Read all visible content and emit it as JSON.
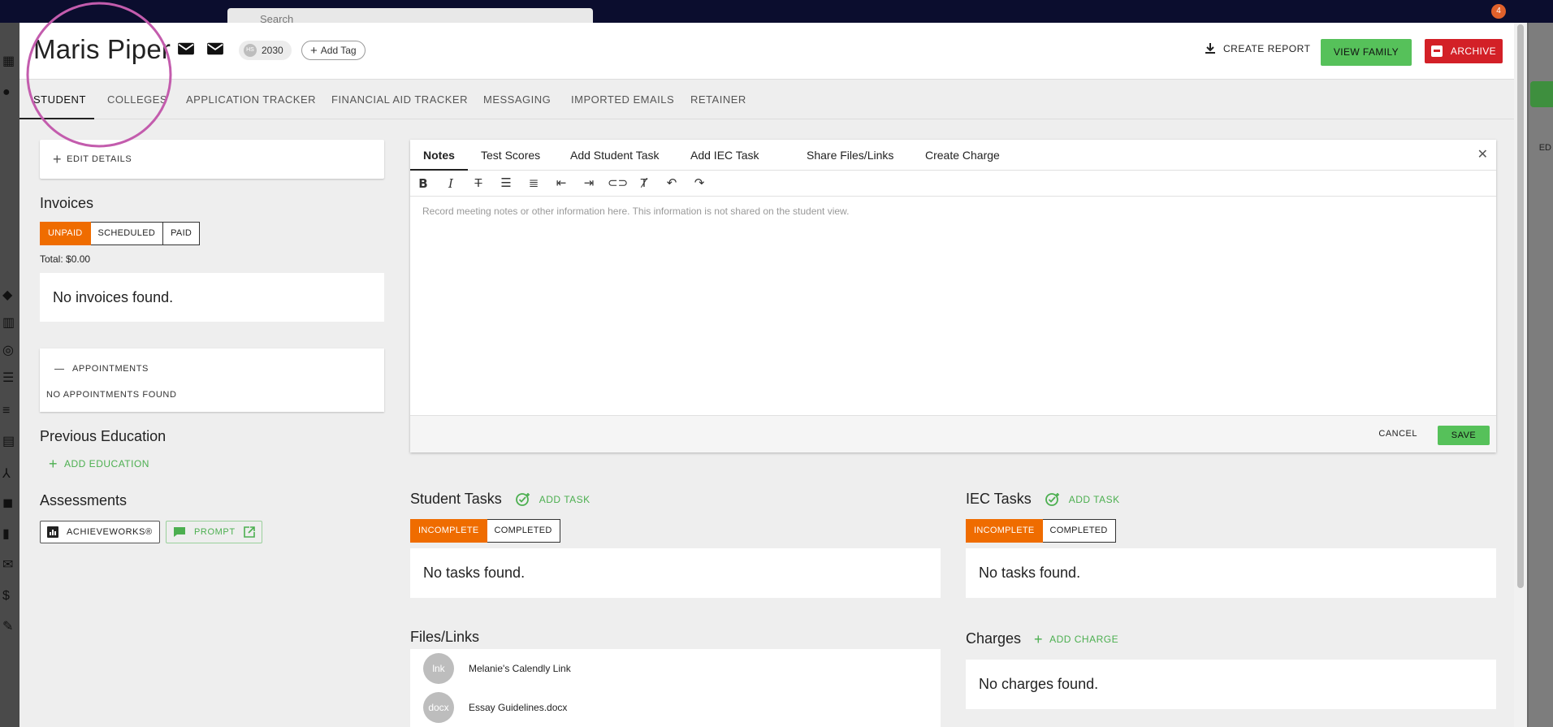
{
  "background": {
    "search_placeholder": "Search",
    "notification_count": "4",
    "right_edge_text": "ED"
  },
  "header": {
    "student_name": "Maris Piper",
    "grad_chip_initials": "HS",
    "grad_year": "2030",
    "add_tag_label": "Add Tag",
    "create_report_label": "CREATE REPORT",
    "view_family_label": "VIEW FAMILY",
    "archive_label": "ARCHIVE"
  },
  "tabs": [
    "STUDENT",
    "COLLEGES",
    "APPLICATION TRACKER",
    "FINANCIAL AID TRACKER",
    "MESSAGING",
    "IMPORTED EMAILS",
    "RETAINER"
  ],
  "left": {
    "edit_details_label": "EDIT DETAILS",
    "invoices_title": "Invoices",
    "invoice_filters": [
      "UNPAID",
      "SCHEDULED",
      "PAID"
    ],
    "invoices_total": "Total: $0.00",
    "invoices_empty": "No invoices found.",
    "appointments_label": "APPOINTMENTS",
    "appointments_empty": "NO APPOINTMENTS FOUND",
    "previous_education_title": "Previous Education",
    "add_education_label": "ADD EDUCATION",
    "assessments_title": "Assessments",
    "achieveworks_label": "ACHIEVEWORKS®",
    "prompt_label": "PROMPT"
  },
  "editor": {
    "tabs": [
      "Notes",
      "Test Scores",
      "Add Student Task",
      "Add IEC Task",
      "Share Files/Links",
      "Create Charge"
    ],
    "placeholder": "Record meeting notes or other information here. This information is not shared on the student view.",
    "cancel_label": "CANCEL",
    "save_label": "SAVE",
    "toolbar_icons": [
      "bold-icon",
      "italic-icon",
      "strikethrough-icon",
      "bullet-list-icon",
      "numbered-list-icon",
      "outdent-icon",
      "indent-icon",
      "link-icon",
      "clear-format-icon",
      "undo-icon",
      "redo-icon"
    ]
  },
  "student_tasks": {
    "title": "Student Tasks",
    "add_label": "ADD TASK",
    "filters": [
      "INCOMPLETE",
      "COMPLETED"
    ],
    "empty": "No tasks found."
  },
  "iec_tasks": {
    "title": "IEC Tasks",
    "add_label": "ADD TASK",
    "filters": [
      "INCOMPLETE",
      "COMPLETED"
    ],
    "empty": "No tasks found."
  },
  "files": {
    "title": "Files/Links",
    "items": [
      {
        "badge": "lnk",
        "name": "Melanie's Calendly Link"
      },
      {
        "badge": "docx",
        "name": "Essay Guidelines.docx"
      }
    ]
  },
  "charges": {
    "title": "Charges",
    "add_label": "ADD CHARGE",
    "empty": "No charges found."
  },
  "colors": {
    "accent_orange": "#ef6c00",
    "green": "#56c15a",
    "archive_red": "#d32027",
    "topbar": "#0b0d2e"
  }
}
